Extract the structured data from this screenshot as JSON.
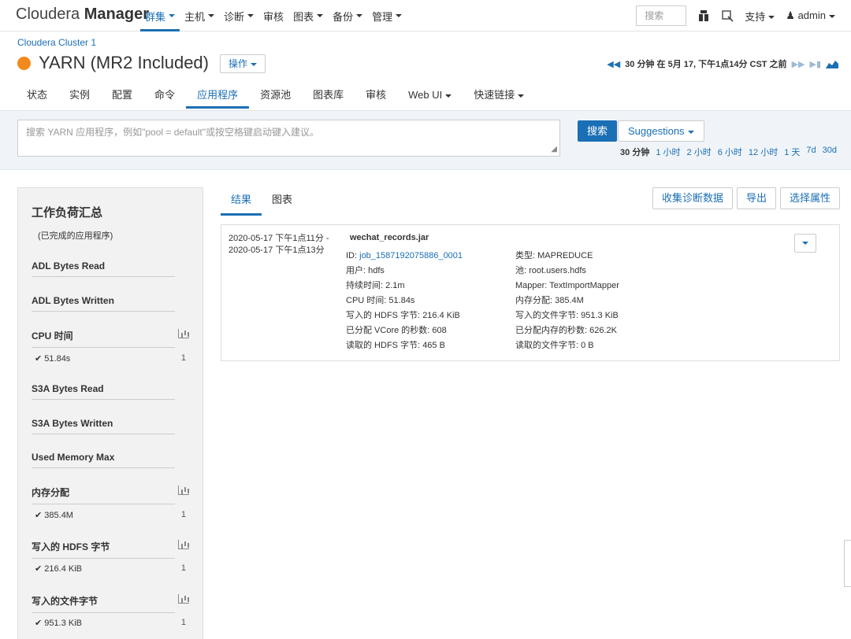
{
  "topnav": {
    "brand_light": "Cloudera",
    "brand_bold": "Manager",
    "menu": [
      {
        "label": "群集"
      },
      {
        "label": "主机"
      },
      {
        "label": "诊断"
      },
      {
        "label": "审核"
      },
      {
        "label": "图表"
      },
      {
        "label": "备份"
      },
      {
        "label": "管理"
      }
    ],
    "search_placeholder": "搜索",
    "support": "支持",
    "user": "admin"
  },
  "header": {
    "cluster": "Cloudera Cluster 1",
    "service": "YARN (MR2 Included)",
    "status_color": "#f28a1b",
    "actions": "操作",
    "time_window": "30 分钟 在 5月 17, 下午1点14分 CST 之前"
  },
  "tabs": [
    "状态",
    "实例",
    "配置",
    "命令",
    "应用程序",
    "资源池",
    "图表库",
    "审核",
    "Web UI",
    "快速链接"
  ],
  "search": {
    "placeholder": "搜索 YARN 应用程序，例如\"pool = default\"或按空格键启动键入建议。",
    "button": "搜索",
    "suggestions": "Suggestions",
    "ranges": [
      "30 分钟",
      "1 小时",
      "2 小时",
      "6 小时",
      "12 小时",
      "1 天",
      "7d",
      "30d"
    ]
  },
  "sidebar": {
    "title": "工作负荷汇总",
    "subtitle": "(已完成的应用程序)",
    "facets": [
      {
        "name": "ADL Bytes Read"
      },
      {
        "name": "ADL Bytes Written"
      },
      {
        "name": "CPU 时间",
        "value": "51.84s",
        "count": "1"
      },
      {
        "name": "S3A Bytes Read"
      },
      {
        "name": "S3A Bytes Written"
      },
      {
        "name": "Used Memory Max"
      },
      {
        "name": "内存分配",
        "value": "385.4M",
        "count": "1"
      },
      {
        "name": "写入的 HDFS 字节",
        "value": "216.4 KiB",
        "count": "1"
      },
      {
        "name": "写入的文件字节",
        "value": "951.3 KiB",
        "count": "1"
      }
    ]
  },
  "results": {
    "tabs": [
      "结果",
      "图表"
    ],
    "buttons": [
      "收集诊断数据",
      "导出",
      "选择属性"
    ],
    "app": {
      "time_start": "2020-05-17 下午1点11分 -",
      "time_end": "2020-05-17 下午1点13分",
      "name": "wechat_records.jar",
      "left": [
        {
          "label": "ID:",
          "value": "job_1587192075886_0001",
          "link": true
        },
        {
          "label": "用户:",
          "value": "hdfs"
        },
        {
          "label": "持续时间:",
          "value": "2.1m"
        },
        {
          "label": "CPU 时间:",
          "value": "51.84s"
        },
        {
          "label": "写入的 HDFS 字节:",
          "value": "216.4 KiB"
        },
        {
          "label": "已分配 VCore 的秒数:",
          "value": "608"
        },
        {
          "label": "读取的 HDFS 字节:",
          "value": "465 B"
        }
      ],
      "right": [
        {
          "label": "类型:",
          "value": "MAPREDUCE"
        },
        {
          "label": "池:",
          "value": "root.users.hdfs"
        },
        {
          "label": "Mapper:",
          "value": "TextImportMapper"
        },
        {
          "label": "内存分配:",
          "value": "385.4M"
        },
        {
          "label": "写入的文件字节:",
          "value": "951.3 KiB"
        },
        {
          "label": "已分配内存的秒数:",
          "value": "626.2K"
        },
        {
          "label": "读取的文件字节:",
          "value": "0 B"
        }
      ]
    }
  }
}
